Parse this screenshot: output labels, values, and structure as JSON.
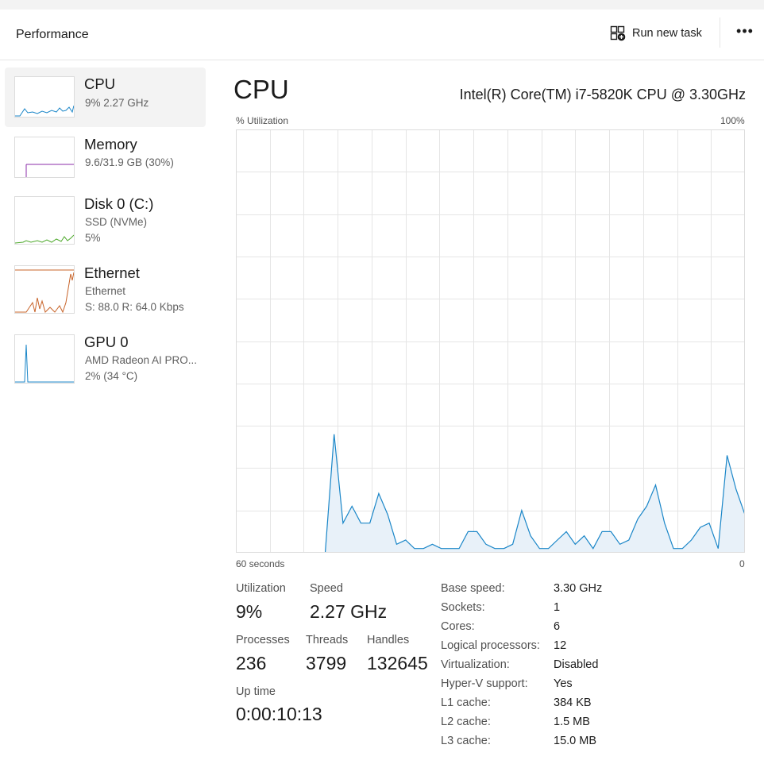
{
  "header": {
    "title": "Performance",
    "run_new_task_label": "Run new task",
    "more_label": "•••"
  },
  "sidebar": {
    "items": [
      {
        "name": "CPU",
        "line1": "9%  2.27 GHz",
        "line2": ""
      },
      {
        "name": "Memory",
        "line1": "9.6/31.9 GB (30%)",
        "line2": ""
      },
      {
        "name": "Disk 0 (C:)",
        "line1": "SSD (NVMe)",
        "line2": "5%"
      },
      {
        "name": "Ethernet",
        "line1": "Ethernet",
        "line2": "S: 88.0  R: 64.0 Kbps"
      },
      {
        "name": "GPU 0",
        "line1": "AMD Radeon AI PRO...",
        "line2": "2%  (34 °C)"
      }
    ]
  },
  "main": {
    "title": "CPU",
    "model": "Intel(R) Core(TM) i7-5820K CPU @ 3.30GHz",
    "y_axis_label": "% Utilization",
    "y_max_label": "100%",
    "x_left_label": "60 seconds",
    "x_right_label": "0",
    "stats": {
      "utilization_label": "Utilization",
      "utilization_value": "9%",
      "speed_label": "Speed",
      "speed_value": "2.27 GHz",
      "processes_label": "Processes",
      "processes_value": "236",
      "threads_label": "Threads",
      "threads_value": "3799",
      "handles_label": "Handles",
      "handles_value": "132645",
      "uptime_label": "Up time",
      "uptime_value": "0:00:10:13"
    },
    "specs": [
      {
        "key": "Base speed:",
        "value": "3.30 GHz"
      },
      {
        "key": "Sockets:",
        "value": "1"
      },
      {
        "key": "Cores:",
        "value": "6"
      },
      {
        "key": "Logical processors:",
        "value": "12"
      },
      {
        "key": "Virtualization:",
        "value": "Disabled"
      },
      {
        "key": "Hyper-V support:",
        "value": "Yes"
      },
      {
        "key": "L1 cache:",
        "value": "384 KB"
      },
      {
        "key": "L2 cache:",
        "value": "1.5 MB"
      },
      {
        "key": "L3 cache:",
        "value": "15.0 MB"
      }
    ]
  },
  "chart_data": {
    "type": "area",
    "x_range_seconds": [
      60,
      0
    ],
    "ylim": [
      0,
      100
    ],
    "grid": true,
    "color": "#1a86c8",
    "fill": "#e8f1f9",
    "values": [
      0,
      0,
      0,
      0,
      0,
      0,
      0,
      0,
      0,
      0,
      0,
      28,
      7,
      11,
      7,
      7,
      14,
      9,
      2,
      3,
      1,
      1,
      2,
      1,
      1,
      1,
      5,
      5,
      2,
      1,
      1,
      2,
      10,
      4,
      1,
      1,
      3,
      5,
      2,
      4,
      1,
      5,
      5,
      2,
      3,
      8,
      11,
      16,
      7,
      1,
      1,
      3,
      6,
      7,
      1,
      23,
      15,
      9
    ]
  },
  "colors": {
    "cpu": "#1a86c8",
    "memory": "#8b2ea8",
    "disk": "#4ca82a",
    "ethernet": "#c8642a",
    "gpu": "#1a86c8",
    "grid": "#e5e5e5"
  }
}
